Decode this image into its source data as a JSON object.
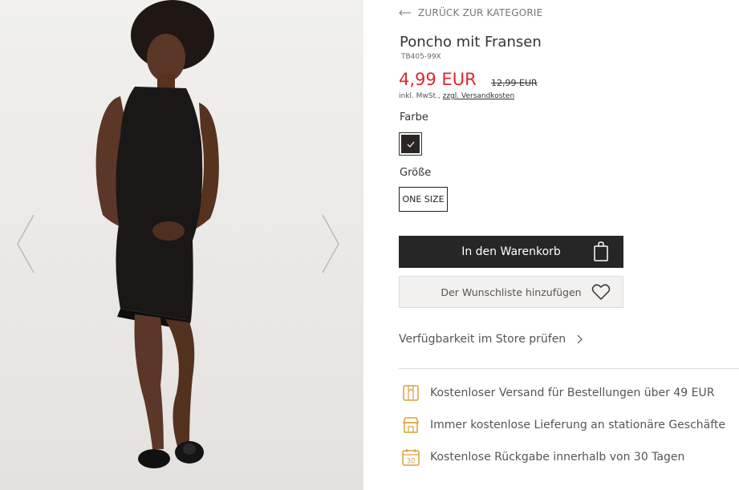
{
  "gallery": {
    "prev_icon": "chevron-left-icon",
    "next_icon": "chevron-right-icon"
  },
  "product": {
    "back_link": "ZURÜCK ZUR KATEGORIE",
    "title": "Poncho mit Fransen",
    "sku": "TB405-99X",
    "price": "4,99 EUR",
    "old_price": "12,99 EUR",
    "tax_text": "inkl. MwSt.,",
    "shipping_link": "zzgl. Versandkosten",
    "color_label": "Farbe",
    "color_swatch": "#2b2624",
    "size_label": "Größe",
    "size_value": "ONE SIZE",
    "cart_button": "In den Warenkorb",
    "wishlist_button": "Der Wunschliste hinzufügen",
    "store_link": "Verfügbarkeit im Store prüfen"
  },
  "benefits": [
    {
      "icon": "shipping-box-icon",
      "text": "Kostenloser Versand für Bestellungen über 49 EUR"
    },
    {
      "icon": "store-icon",
      "text": "Immer kostenlose Lieferung an stationäre Geschäfte"
    },
    {
      "icon": "calendar-30-icon",
      "text": "Kostenlose Rückgabe innerhalb von 30 Tagen"
    }
  ],
  "colors": {
    "accent_price": "#e2262d",
    "button_dark": "#272626",
    "icon_gold": "#d9a03d"
  }
}
